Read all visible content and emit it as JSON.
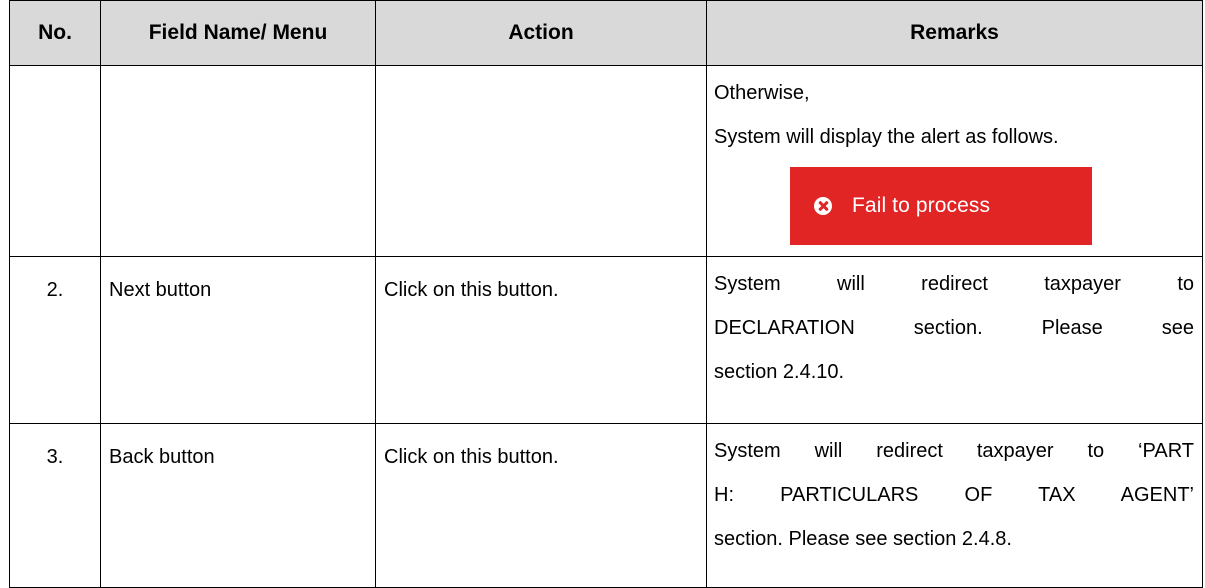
{
  "table": {
    "headers": {
      "no": "No.",
      "field": "Field Name/ Menu",
      "action": "Action",
      "remarks": "Remarks"
    },
    "row1": {
      "remarks_line1": "Otherwise,",
      "remarks_line2": "System will display the alert as follows.",
      "alert": {
        "icon": "close-circle-icon",
        "text": "Fail to process",
        "color": "#e12424"
      }
    },
    "row2": {
      "no": "2.",
      "field": "Next button",
      "action": "Click on this button.",
      "remarks_line1": "System will redirect taxpayer to",
      "remarks_line2": "DECLARATION section. Please see",
      "remarks_line3": "section 2.4.10."
    },
    "row3": {
      "no": "3.",
      "field": "Back button",
      "action": "Click on this button.",
      "remarks_line1": "System will redirect taxpayer to ‘PART",
      "remarks_line2": "H: PARTICULARS OF TAX AGENT’",
      "remarks_line3": "section. Please see section 2.4.8."
    }
  }
}
